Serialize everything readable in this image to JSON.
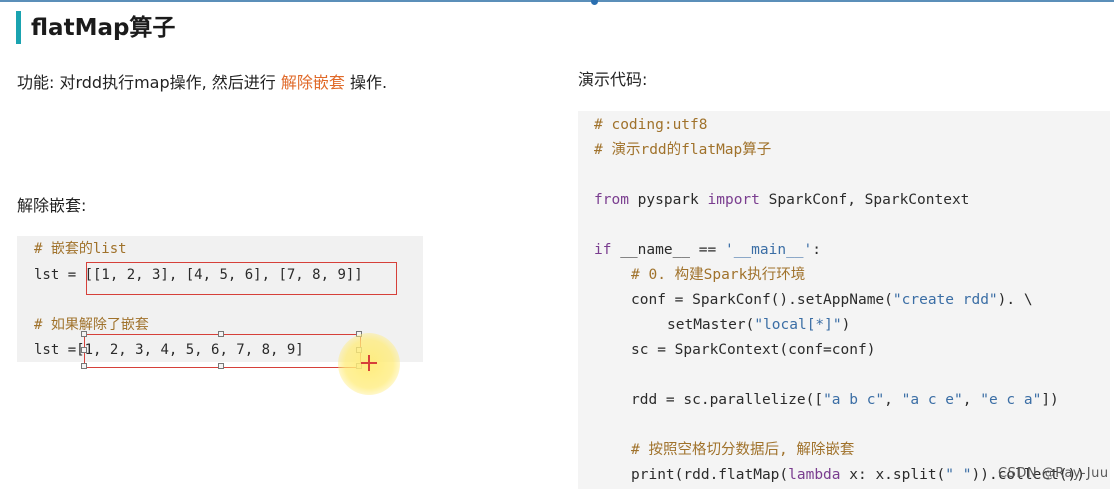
{
  "title": "flatMap算子",
  "description": {
    "prefix": "功能: 对rdd执行map操作, 然后进行 ",
    "highlight": "解除嵌套",
    "suffix": " 操作."
  },
  "section_label": "解除嵌套:",
  "left_code": {
    "comment1": "# 嵌套的list",
    "line1_prefix": "lst = ",
    "line1_value": "[[1, 2, 3], [4, 5, 6], [7, 8, 9]]",
    "comment2": "# 如果解除了嵌套",
    "line2_prefix": "lst =",
    "line2_value": "[1, 2, 3, 4, 5, 6, 7, 8, 9]"
  },
  "demo_label": "演示代码:",
  "right_code": {
    "l1": "# coding:utf8",
    "l2": "# 演示rdd的flatMap算子",
    "l3_kw1": "from",
    "l3_mid": " pyspark ",
    "l3_kw2": "import",
    "l3_end": " SparkConf, SparkContext",
    "l4_kw": "if",
    "l4_mid": " __name__ == ",
    "l4_str": "'__main__'",
    "l4_end": ":",
    "l5": "# 0. 构建Spark执行环境",
    "l6_a": "conf = SparkConf().setAppName(",
    "l6_str": "\"create rdd\"",
    "l6_b": "). \\",
    "l7_a": "setMaster(",
    "l7_str": "\"local[*]\"",
    "l7_b": ")",
    "l8": "sc = SparkContext(conf=conf)",
    "l9_a": "rdd = sc.parallelize([",
    "l9_s1": "\"a b c\"",
    "l9_c1": ", ",
    "l9_s2": "\"a c e\"",
    "l9_c2": ", ",
    "l9_s3": "\"e c a\"",
    "l9_b": "])",
    "l10": "# 按照空格切分数据后, 解除嵌套",
    "l11_a": "print(rdd.flatMap(",
    "l11_kw": "lambda",
    "l11_b": " x: x.split(",
    "l11_str": "\" \"",
    "l11_c": ")).collect())"
  },
  "watermark": "CSDN @Ray-Juu",
  "colors": {
    "accent_bar": "#1aa3b0",
    "highlight": "#e06a2a",
    "annotation_box": "#d6403a"
  }
}
